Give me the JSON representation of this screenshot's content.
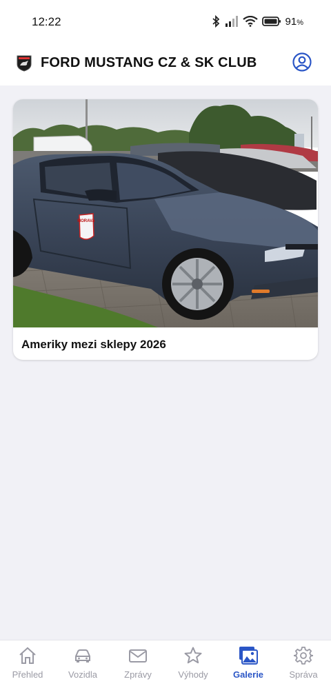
{
  "status": {
    "time": "12:22",
    "battery": "91",
    "battery_unit": "%"
  },
  "appbar": {
    "title": "FORD MUSTANG CZ & SK CLUB",
    "logo_icon": "club-logo-icon",
    "profile_icon": "account-circle-icon"
  },
  "gallery": {
    "items": [
      {
        "title": "Ameriky mezi sklepy 2026",
        "door_decal": "MORAVA"
      }
    ]
  },
  "nav": {
    "items": [
      {
        "label": "Přehled",
        "icon": "home-icon",
        "active": false
      },
      {
        "label": "Vozidla",
        "icon": "car-icon",
        "active": false
      },
      {
        "label": "Zprávy",
        "icon": "mail-icon",
        "active": false
      },
      {
        "label": "Výhody",
        "icon": "star-icon",
        "active": false
      },
      {
        "label": "Galerie",
        "icon": "gallery-icon",
        "active": true
      },
      {
        "label": "Správa",
        "icon": "gear-icon",
        "active": false
      }
    ]
  },
  "colors": {
    "accent": "#2b56c6",
    "inactive": "#9a9aa4",
    "background": "#f1f1f6"
  }
}
